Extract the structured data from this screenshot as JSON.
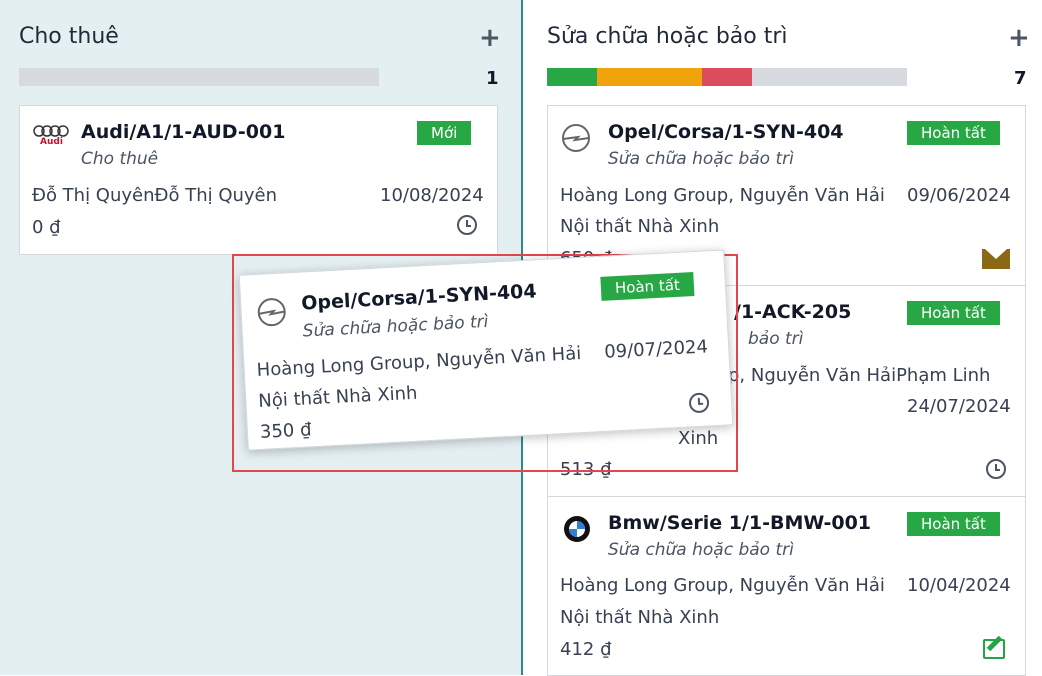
{
  "columns": [
    {
      "title": "Cho thuê",
      "count": "1",
      "progress": [
        {
          "color": "#d7dadf",
          "fraction": 1
        }
      ]
    },
    {
      "title": "Sửa chữa hoặc bảo trì",
      "count": "7",
      "progress": [
        {
          "color": "#28a745",
          "fraction": 0.14
        },
        {
          "color": "#f0a30a",
          "fraction": 0.29
        },
        {
          "color": "#dc4c5e",
          "fraction": 0.14
        },
        {
          "color": "#d7dadf",
          "fraction": 0.43
        }
      ]
    }
  ],
  "icons": {
    "add": "plus-icon",
    "clock": "clock-icon",
    "mail": "envelope-icon",
    "edit": "edit-icon"
  },
  "cards": {
    "audi": {
      "name": "Audi/A1/1-AUD-001",
      "stage": "Cho thuê",
      "customer": "Đỗ Thị QuyênĐỗ Thị Quyên",
      "date": "10/08/2024",
      "price": "0 ₫",
      "badge": "Mới",
      "logo_text": "Audi"
    },
    "opel1": {
      "name": "Opel/Corsa/1-SYN-404",
      "stage": "Sửa chữa hoặc bảo trì",
      "customer": "Hoàng Long Group, Nguyễn Văn Hải",
      "date": "09/06/2024",
      "company": "Nội thất Nhà Xinh",
      "price": "650 ₫",
      "badge": "Hoàn tất"
    },
    "ack": {
      "name": "/1-ACK-205",
      "stage": "bảo trì",
      "customer": "p, Nguyễn Văn HảiPhạm Linh",
      "date": "24/07/2024",
      "company": "Xinh",
      "price": "513 ₫",
      "badge": "Hoàn tất"
    },
    "bmw": {
      "name": "Bmw/Serie 1/1-BMW-001",
      "stage": "Sửa chữa hoặc bảo trì",
      "customer": "Hoàng Long Group, Nguyễn Văn Hải",
      "date": "10/04/2024",
      "company": "Nội thất Nhà Xinh",
      "price": "412 ₫",
      "badge": "Hoàn tất"
    },
    "dragged": {
      "name": "Opel/Corsa/1-SYN-404",
      "stage": "Sửa chữa hoặc bảo trì",
      "customer": "Hoàng Long Group, Nguyễn Văn Hải",
      "date": "09/07/2024",
      "company": "Nội thất Nhà Xinh",
      "price": "350 ₫",
      "badge": "Hoàn tất"
    }
  }
}
